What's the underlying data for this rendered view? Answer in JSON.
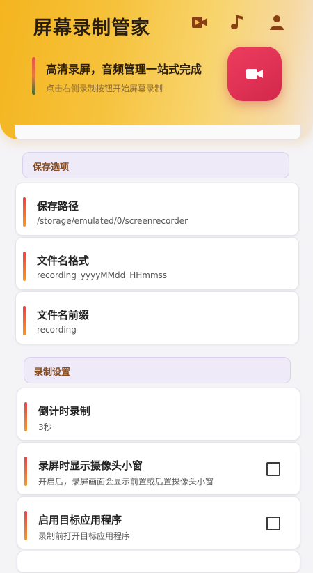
{
  "header": {
    "app_title": "屏幕录制管家",
    "hero_title": "高清录屏，音频管理一站式完成",
    "hero_subtitle": "点击右侧录制按钮开始屏幕录制",
    "icons": [
      "video-library-icon",
      "music-note-icon",
      "user-icon"
    ]
  },
  "sections": {
    "save": "保存选项",
    "record": "录制设置"
  },
  "save_options": [
    {
      "title": "保存路径",
      "value": "/storage/emulated/0/screenrecorder"
    },
    {
      "title": "文件名格式",
      "value": "recording_yyyyMMdd_HHmmss"
    },
    {
      "title": "文件名前缀",
      "value": "recording"
    }
  ],
  "record_settings": [
    {
      "title": "倒计时录制",
      "value": "3秒"
    },
    {
      "title": "录屏时显示摄像头小窗",
      "value": "开启后，录屏画面会显示前置或后置摄像头小窗",
      "checked": false
    },
    {
      "title": "启用目标应用程序",
      "value": "录制前打开目标应用程序",
      "checked": false
    }
  ],
  "colors": {
    "accent_red": "#e0304f",
    "header_gold": "#f4b51f",
    "section_text": "#8a4a1a"
  }
}
